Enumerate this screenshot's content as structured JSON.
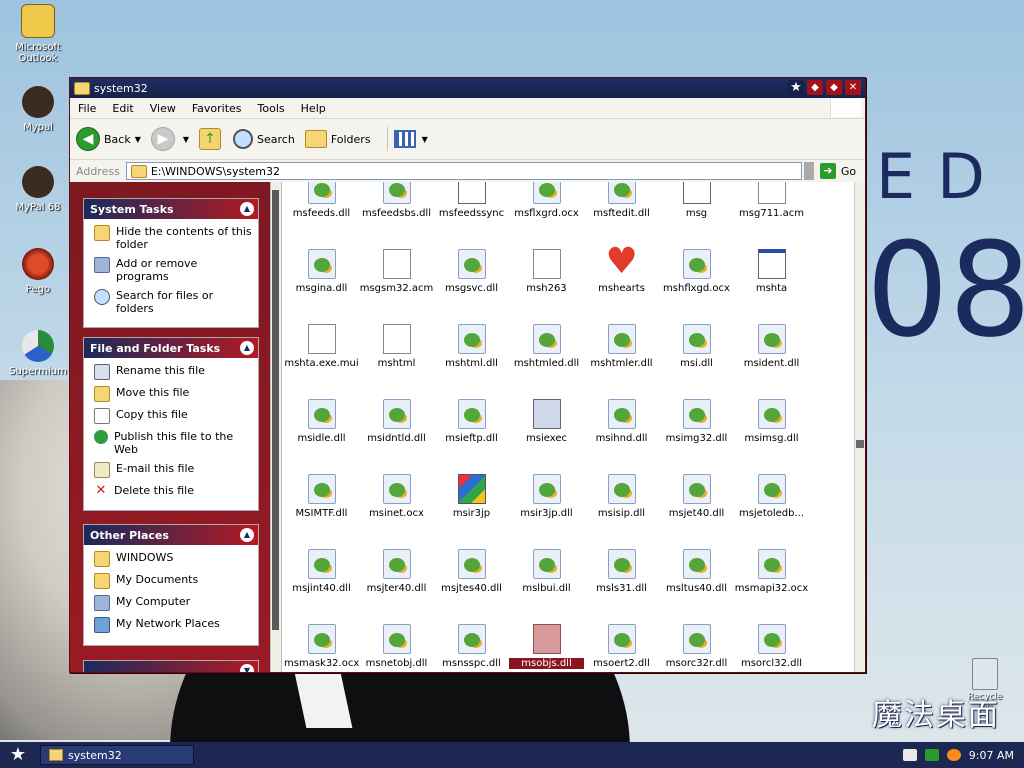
{
  "desktop": {
    "icons": [
      {
        "label": "Microsoft Outlook"
      },
      {
        "label": "Mypal"
      },
      {
        "label": "MyPal 68"
      },
      {
        "label": "Pego"
      },
      {
        "label": "Supermium"
      }
    ],
    "recycle_label": "Recycle Bin",
    "bg_text_1": "ED",
    "bg_text_2": "08",
    "logo_text": "魔法桌面"
  },
  "window": {
    "title": "system32",
    "menu": [
      "File",
      "Edit",
      "View",
      "Favorites",
      "Tools",
      "Help"
    ],
    "toolbar": {
      "back": "Back",
      "search": "Search",
      "folders": "Folders"
    },
    "address": {
      "label": "Address",
      "value": "E:\\WINDOWS\\system32",
      "go": "Go"
    }
  },
  "taskpane": {
    "system_tasks": {
      "title": "System Tasks",
      "items": [
        {
          "label": "Hide the contents of this folder",
          "icon": "folder-hide-icon"
        },
        {
          "label": "Add or remove programs",
          "icon": "programs-icon"
        },
        {
          "label": "Search for files or folders",
          "icon": "search-icon"
        }
      ]
    },
    "file_tasks": {
      "title": "File and Folder Tasks",
      "items": [
        {
          "label": "Rename this file",
          "icon": "rename-icon"
        },
        {
          "label": "Move this file",
          "icon": "move-icon"
        },
        {
          "label": "Copy this file",
          "icon": "copy-icon"
        },
        {
          "label": "Publish this file to the Web",
          "icon": "globe-icon"
        },
        {
          "label": "E-mail this file",
          "icon": "email-icon"
        },
        {
          "label": "Delete this file",
          "icon": "delete-icon"
        }
      ]
    },
    "other_places": {
      "title": "Other Places",
      "items": [
        {
          "label": "WINDOWS",
          "icon": "folder-icon"
        },
        {
          "label": "My Documents",
          "icon": "documents-icon"
        },
        {
          "label": "My Computer",
          "icon": "computer-icon"
        },
        {
          "label": "My Network Places",
          "icon": "network-icon"
        }
      ]
    }
  },
  "files": [
    {
      "name": "msfeeds.dll",
      "type": "dll"
    },
    {
      "name": "msfeedsbs.dll",
      "type": "dll"
    },
    {
      "name": "msfeedssync",
      "type": "app"
    },
    {
      "name": "msflxgrd.ocx",
      "type": "dll"
    },
    {
      "name": "msftedit.dll",
      "type": "dll"
    },
    {
      "name": "msg",
      "type": "app"
    },
    {
      "name": "msg711.acm",
      "type": "doc"
    },
    {
      "name": "msgina.dll",
      "type": "dll"
    },
    {
      "name": "msgsm32.acm",
      "type": "doc"
    },
    {
      "name": "msgsvc.dll",
      "type": "dll"
    },
    {
      "name": "msh263",
      "type": "doc"
    },
    {
      "name": "mshearts",
      "type": "heart"
    },
    {
      "name": "mshflxgd.ocx",
      "type": "dll"
    },
    {
      "name": "mshta",
      "type": "app"
    },
    {
      "name": "mshta.exe.mui",
      "type": "doc"
    },
    {
      "name": "mshtml",
      "type": "doc"
    },
    {
      "name": "mshtml.dll",
      "type": "dll"
    },
    {
      "name": "mshtmled.dll",
      "type": "dll"
    },
    {
      "name": "mshtmler.dll",
      "type": "dll"
    },
    {
      "name": "msi.dll",
      "type": "dll"
    },
    {
      "name": "msident.dll",
      "type": "dll"
    },
    {
      "name": "msidle.dll",
      "type": "dll"
    },
    {
      "name": "msidntld.dll",
      "type": "dll"
    },
    {
      "name": "msieftp.dll",
      "type": "dll"
    },
    {
      "name": "msiexec",
      "type": "setup"
    },
    {
      "name": "msihnd.dll",
      "type": "dll"
    },
    {
      "name": "msimg32.dll",
      "type": "dll"
    },
    {
      "name": "msimsg.dll",
      "type": "dll"
    },
    {
      "name": "MSIMTF.dll",
      "type": "dll"
    },
    {
      "name": "msinet.ocx",
      "type": "dll"
    },
    {
      "name": "msir3jp",
      "type": "puzzle"
    },
    {
      "name": "msir3jp.dll",
      "type": "dll"
    },
    {
      "name": "msisip.dll",
      "type": "dll"
    },
    {
      "name": "msjet40.dll",
      "type": "dll"
    },
    {
      "name": "msjetoledb...",
      "type": "dll"
    },
    {
      "name": "msjint40.dll",
      "type": "dll"
    },
    {
      "name": "msjter40.dll",
      "type": "dll"
    },
    {
      "name": "msjtes40.dll",
      "type": "dll"
    },
    {
      "name": "mslbui.dll",
      "type": "dll"
    },
    {
      "name": "msls31.dll",
      "type": "dll"
    },
    {
      "name": "msltus40.dll",
      "type": "dll"
    },
    {
      "name": "msmapi32.ocx",
      "type": "dll"
    },
    {
      "name": "msmask32.ocx",
      "type": "dll"
    },
    {
      "name": "msnetobj.dll",
      "type": "dll"
    },
    {
      "name": "msnsspc.dll",
      "type": "dll"
    },
    {
      "name": "msobjs.dll",
      "type": "red",
      "selected": true
    },
    {
      "name": "msoert2.dll",
      "type": "dll"
    },
    {
      "name": "msorc32r.dll",
      "type": "dll"
    },
    {
      "name": "msorcl32.dll",
      "type": "dll"
    }
  ],
  "taskbar": {
    "task": "system32",
    "clock": "9:07 AM"
  },
  "colors": {
    "titlebar": "#1f2f63",
    "accent_red": "#9a1a24",
    "taskbar": "#1c2752"
  }
}
